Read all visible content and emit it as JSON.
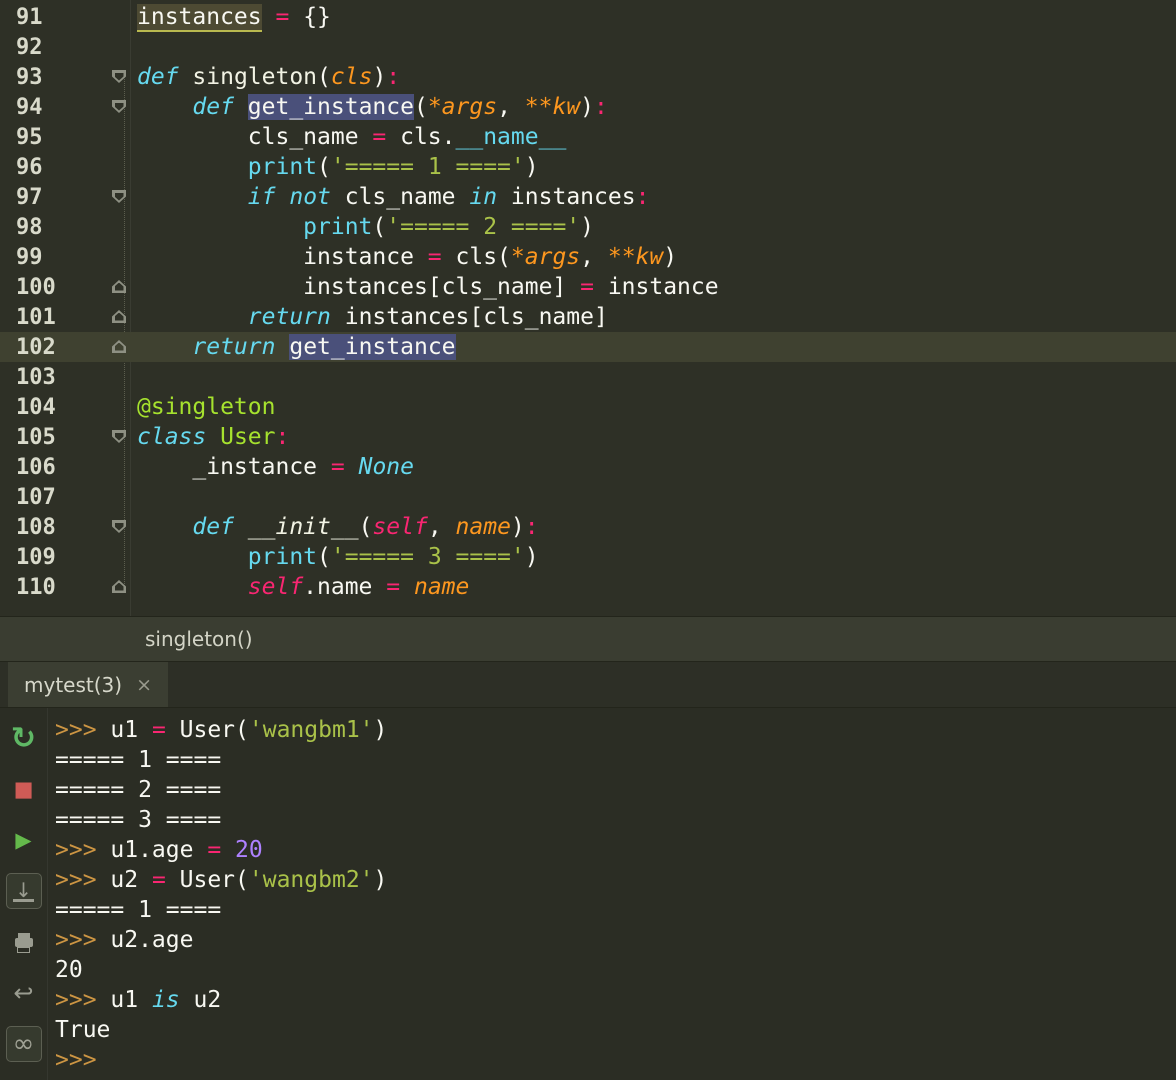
{
  "app": {
    "name": "pycharm-editor-with-python-console"
  },
  "colors": {
    "editor_bg": "#2e3026",
    "console_bg": "#2b2d24",
    "current_line": "#3f4130",
    "keyword": "#66d9ef",
    "operator": "#f92672",
    "string": "#aac249",
    "orange_param": "#fd971f",
    "number": "#ae81ff",
    "decorator": "#a6e22e",
    "plain": "#f8f8f2",
    "prompt": "#cc9543",
    "id_highlight_bg": "#4a507a",
    "run_green": "#64b94b",
    "stop_red": "#cf5b56"
  },
  "editor": {
    "current_line_num": "102",
    "lines": [
      {
        "num": "91",
        "tokens": [
          [
            "instances",
            "ref"
          ],
          [
            " ",
            "p"
          ],
          [
            "=",
            "op"
          ],
          [
            " {}",
            "p"
          ]
        ]
      },
      {
        "num": "92",
        "tokens": []
      },
      {
        "num": "93",
        "fold": "down",
        "tokens": [
          [
            "def",
            "kw"
          ],
          [
            " ",
            "p"
          ],
          [
            "singleton",
            "fn"
          ],
          [
            "(",
            "p"
          ],
          [
            "cls",
            "oi"
          ],
          [
            ")",
            "p"
          ],
          [
            ":",
            "op"
          ]
        ]
      },
      {
        "num": "94",
        "fold": "down",
        "tokens": [
          [
            "    ",
            "p"
          ],
          [
            "def",
            "kw"
          ],
          [
            " ",
            "p"
          ],
          [
            "get_instance",
            "hlid"
          ],
          [
            "(",
            "p"
          ],
          [
            "*args",
            "oi"
          ],
          [
            ", ",
            "p"
          ],
          [
            "**kw",
            "oi"
          ],
          [
            ")",
            "p"
          ],
          [
            ":",
            "op"
          ]
        ]
      },
      {
        "num": "95",
        "tokens": [
          [
            "        cls_name ",
            "p"
          ],
          [
            "=",
            "op"
          ],
          [
            " cls.",
            "p"
          ],
          [
            "__name__",
            "dund"
          ]
        ]
      },
      {
        "num": "96",
        "tokens": [
          [
            "        ",
            "p"
          ],
          [
            "print",
            "bi"
          ],
          [
            "(",
            "p"
          ],
          [
            "'===== 1 ===='",
            "str"
          ],
          [
            ")",
            "p"
          ]
        ]
      },
      {
        "num": "97",
        "fold": "down",
        "tokens": [
          [
            "        ",
            "p"
          ],
          [
            "if",
            "kw"
          ],
          [
            " ",
            "p"
          ],
          [
            "not",
            "kw"
          ],
          [
            " cls_name ",
            "p"
          ],
          [
            "in",
            "kw"
          ],
          [
            " instances",
            "p"
          ],
          [
            ":",
            "op"
          ]
        ]
      },
      {
        "num": "98",
        "tokens": [
          [
            "            ",
            "p"
          ],
          [
            "print",
            "bi"
          ],
          [
            "(",
            "p"
          ],
          [
            "'===== 2 ===='",
            "str"
          ],
          [
            ")",
            "p"
          ]
        ]
      },
      {
        "num": "99",
        "tokens": [
          [
            "            instance ",
            "p"
          ],
          [
            "=",
            "op"
          ],
          [
            " cls(",
            "p"
          ],
          [
            "*args",
            "oi"
          ],
          [
            ", ",
            "p"
          ],
          [
            "**kw",
            "oi"
          ],
          [
            ")",
            "p"
          ]
        ]
      },
      {
        "num": "100",
        "fold": "up",
        "tokens": [
          [
            "            instances[cls_name] ",
            "p"
          ],
          [
            "=",
            "op"
          ],
          [
            " instance",
            "p"
          ]
        ]
      },
      {
        "num": "101",
        "fold": "up",
        "tokens": [
          [
            "        ",
            "p"
          ],
          [
            "return",
            "kw"
          ],
          [
            " instances[cls_name]",
            "p"
          ]
        ]
      },
      {
        "num": "102",
        "fold": "up",
        "current": true,
        "tokens": [
          [
            "    ",
            "p"
          ],
          [
            "return",
            "kw"
          ],
          [
            " ",
            "p"
          ],
          [
            "get_instance",
            "hlid"
          ]
        ]
      },
      {
        "num": "103",
        "tokens": []
      },
      {
        "num": "104",
        "tokens": [
          [
            "@singleton",
            "dec"
          ]
        ]
      },
      {
        "num": "105",
        "fold": "down",
        "tokens": [
          [
            "class",
            "kw"
          ],
          [
            " ",
            "p"
          ],
          [
            "User",
            "cls"
          ],
          [
            ":",
            "op"
          ]
        ]
      },
      {
        "num": "106",
        "tokens": [
          [
            "    _instance ",
            "p"
          ],
          [
            "=",
            "op"
          ],
          [
            " ",
            "p"
          ],
          [
            "None",
            "kw"
          ]
        ]
      },
      {
        "num": "107",
        "tokens": []
      },
      {
        "num": "108",
        "fold": "down",
        "tokens": [
          [
            "    ",
            "p"
          ],
          [
            "def",
            "kw"
          ],
          [
            " ",
            "p"
          ],
          [
            "__init__",
            "fni"
          ],
          [
            "(",
            "p"
          ],
          [
            "self",
            "selfp"
          ],
          [
            ", ",
            "p"
          ],
          [
            "name",
            "oi"
          ],
          [
            ")",
            "p"
          ],
          [
            ":",
            "op"
          ]
        ]
      },
      {
        "num": "109",
        "tokens": [
          [
            "        ",
            "p"
          ],
          [
            "print",
            "bi"
          ],
          [
            "(",
            "p"
          ],
          [
            "'===== 3 ===='",
            "str"
          ],
          [
            ")",
            "p"
          ]
        ]
      },
      {
        "num": "110",
        "fold": "up",
        "tokens": [
          [
            "        ",
            "p"
          ],
          [
            "self",
            "selfp"
          ],
          [
            ".name ",
            "p"
          ],
          [
            "=",
            "op"
          ],
          [
            " ",
            "p"
          ],
          [
            "name",
            "oi"
          ]
        ]
      }
    ]
  },
  "breadcrumb": {
    "text": "singleton()"
  },
  "console": {
    "tab": {
      "label": "mytest(3)",
      "close_glyph": "×"
    },
    "toolbar": [
      {
        "name": "rerun-icon"
      },
      {
        "name": "stop-icon"
      },
      {
        "name": "run-icon"
      },
      {
        "name": "scroll-to-end-icon",
        "boxed": true
      },
      {
        "name": "print-icon"
      },
      {
        "name": "soft-wrap-icon"
      },
      {
        "name": "infinity-icon",
        "boxed": true
      }
    ],
    "lines": [
      {
        "tokens": [
          [
            ">>> ",
            "prompt"
          ],
          [
            "u1 ",
            "p"
          ],
          [
            "=",
            "op"
          ],
          [
            " User(",
            "p"
          ],
          [
            "'wangbm1'",
            "str"
          ],
          [
            ")",
            "p"
          ]
        ]
      },
      {
        "tokens": [
          [
            "===== 1 ====",
            "p"
          ]
        ]
      },
      {
        "tokens": [
          [
            "===== 2 ====",
            "p"
          ]
        ]
      },
      {
        "tokens": [
          [
            "===== 3 ====",
            "p"
          ]
        ]
      },
      {
        "tokens": [
          [
            ">>> ",
            "prompt"
          ],
          [
            "u1.age ",
            "p"
          ],
          [
            "=",
            "op"
          ],
          [
            " ",
            "p"
          ],
          [
            "20",
            "num"
          ]
        ]
      },
      {
        "tokens": [
          [
            ">>> ",
            "prompt"
          ],
          [
            "u2 ",
            "p"
          ],
          [
            "=",
            "op"
          ],
          [
            " User(",
            "p"
          ],
          [
            "'wangbm2'",
            "str"
          ],
          [
            ")",
            "p"
          ]
        ]
      },
      {
        "tokens": [
          [
            "===== 1 ====",
            "p"
          ]
        ]
      },
      {
        "tokens": [
          [
            ">>> ",
            "prompt"
          ],
          [
            "u2.age",
            "p"
          ]
        ]
      },
      {
        "tokens": [
          [
            "20",
            "p"
          ]
        ]
      },
      {
        "tokens": [
          [
            ">>> ",
            "prompt"
          ],
          [
            "u1 ",
            "p"
          ],
          [
            "is",
            "kw"
          ],
          [
            " u2",
            "p"
          ]
        ]
      },
      {
        "tokens": [
          [
            "True",
            "p"
          ]
        ]
      },
      {
        "tokens": [
          [
            ">>>",
            "prompt"
          ]
        ]
      }
    ]
  }
}
